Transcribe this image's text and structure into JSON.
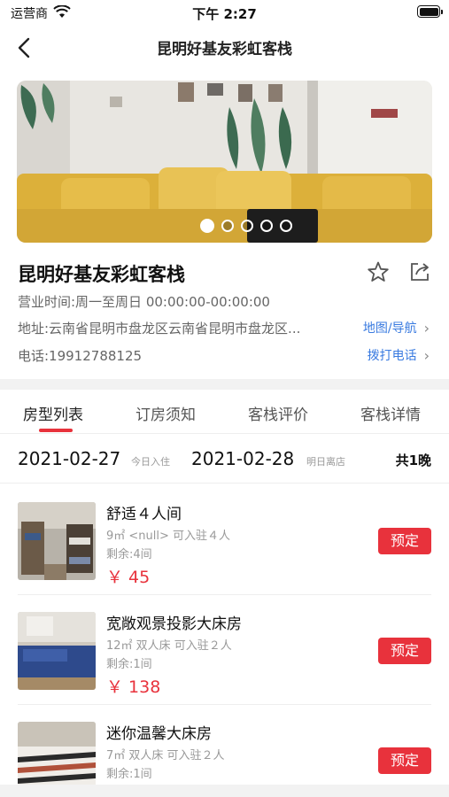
{
  "status_bar": {
    "carrier": "运营商",
    "time": "下午 2:27"
  },
  "nav": {
    "title": "昆明好基友彩虹客栈"
  },
  "hero": {
    "slide_count": 5,
    "active_index": 0
  },
  "hotel": {
    "name": "昆明好基友彩虹客栈",
    "hours": "营业时间:周一至周日 00:00:00-00:00:00",
    "address": "地址:云南省昆明市盘龙区云南省昆明市盘龙区...",
    "phone": "电话:19912788125",
    "map_link": "地图/导航",
    "call_link": "拨打电话"
  },
  "tabs": [
    {
      "label": "房型列表"
    },
    {
      "label": "订房须知"
    },
    {
      "label": "客栈评价"
    },
    {
      "label": "客栈详情"
    }
  ],
  "dates": {
    "checkin": "2021-02-27",
    "checkin_label": "今日入住",
    "checkout": "2021-02-28",
    "checkout_label": "明日离店",
    "nights": "共1晚"
  },
  "rooms": [
    {
      "name": "舒适４人间",
      "spec": "9㎡ <null> 可入驻４人",
      "remaining": "剩余:4间",
      "price": "￥ 45",
      "book": "预定"
    },
    {
      "name": "宽敞观景投影大床房",
      "spec": "12㎡ 双人床 可入驻２人",
      "remaining": "剩余:1间",
      "price": "￥ 138",
      "book": "预定"
    },
    {
      "name": "迷你温馨大床房",
      "spec": "7㎡ 双人床 可入驻２人",
      "remaining": "剩余:1间",
      "price": "",
      "book": "预定"
    }
  ],
  "colors": {
    "accent": "#e8323c",
    "link": "#3a7be0"
  }
}
